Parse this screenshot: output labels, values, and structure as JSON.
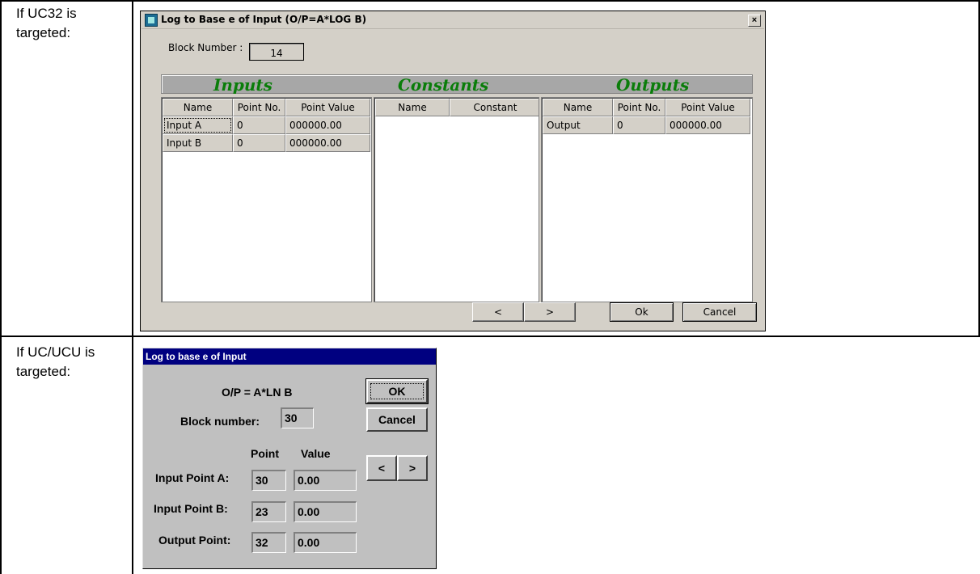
{
  "doc": {
    "row1_label": "If UC32 is targeted:",
    "row2_label": "If UC/UCU is targeted:"
  },
  "dialog1": {
    "title": "Log to Base e of Input (O/P=A*LOG B)",
    "close_label": "×",
    "block_number_label": "Block Number :",
    "block_number_value": "14",
    "sections": {
      "inputs": "Inputs",
      "constants": "Constants",
      "outputs": "Outputs"
    },
    "inputs": {
      "headers": [
        "Name",
        "Point No.",
        "Point Value"
      ],
      "rows": [
        {
          "name": "Input A",
          "point": "0",
          "value": "000000.00"
        },
        {
          "name": "Input B",
          "point": "0",
          "value": "000000.00"
        }
      ]
    },
    "constants": {
      "headers": [
        "Name",
        "Constant"
      ]
    },
    "outputs": {
      "headers": [
        "Name",
        "Point No.",
        "Point Value"
      ],
      "rows": [
        {
          "name": "Output",
          "point": "0",
          "value": "000000.00"
        }
      ]
    },
    "buttons": {
      "prev": "<",
      "next": ">",
      "ok": "Ok",
      "cancel": "Cancel"
    },
    "colors": {
      "section_title": "#0a7d0a",
      "dialog_bg": "#d4d0c8"
    }
  },
  "dialog2": {
    "title": "Log to base e of Input",
    "formula": "O/P = A*LN B",
    "block_number_label": "Block number:",
    "block_number_value": "30",
    "col_point": "Point",
    "col_value": "Value",
    "rows": [
      {
        "label": "Input Point A:",
        "point": "30",
        "value": "0.00"
      },
      {
        "label": "Input Point B:",
        "point": "23",
        "value": "0.00"
      },
      {
        "label": "Output Point:",
        "point": "32",
        "value": "0.00"
      }
    ],
    "buttons": {
      "ok": "OK",
      "cancel": "Cancel",
      "prev": "<",
      "next": ">"
    },
    "colors": {
      "titlebar": "#000080",
      "dialog_bg": "#c0c0c0"
    }
  }
}
